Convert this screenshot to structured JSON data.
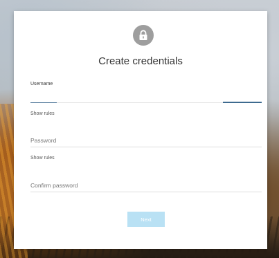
{
  "dialog": {
    "title": "Create credentials",
    "lock_icon": "lock-icon",
    "colors": {
      "icon_circle": "#9e9e9e",
      "focus_underline": "#3d6a8f",
      "button_disabled": "#b9e1f4"
    }
  },
  "username": {
    "label": "Username",
    "value": "",
    "show_rules": "Show rules"
  },
  "password": {
    "placeholder": "Password",
    "show_rules": "Show rules"
  },
  "confirm_password": {
    "placeholder": "Confirm password"
  },
  "actions": {
    "next_label": "Next",
    "next_enabled": false
  }
}
